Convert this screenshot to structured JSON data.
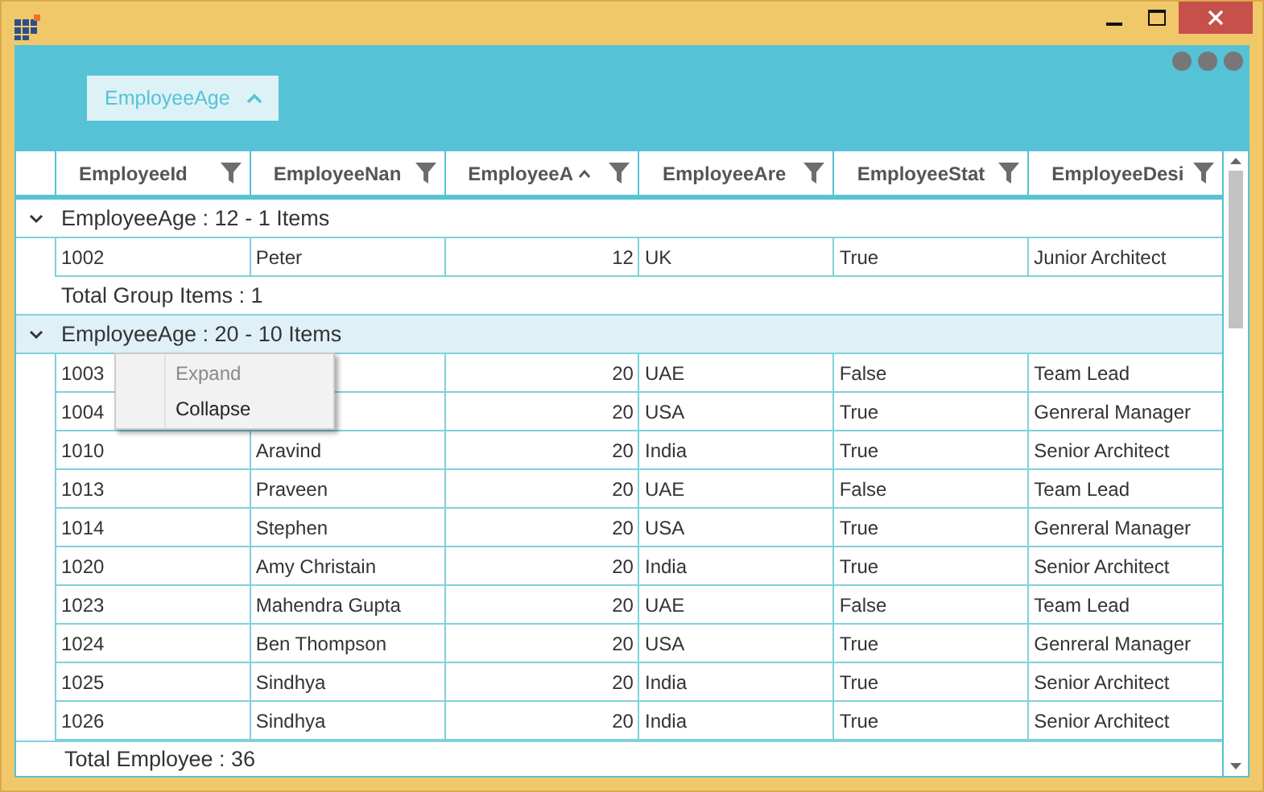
{
  "group_drop_area": {
    "grouped_columns": [
      {
        "label": "EmployeeAge",
        "sorted": true
      }
    ]
  },
  "columns": [
    {
      "label": "EmployeeId",
      "numeric": false,
      "sorted": false
    },
    {
      "label": "EmployeeNan",
      "numeric": false,
      "sorted": false
    },
    {
      "label": "EmployeeA",
      "numeric": true,
      "sorted": true
    },
    {
      "label": "EmployeeAre",
      "numeric": false,
      "sorted": false
    },
    {
      "label": "EmployeeStat",
      "numeric": false,
      "sorted": false
    },
    {
      "label": "EmployeeDesi",
      "numeric": false,
      "sorted": false
    }
  ],
  "groups": [
    {
      "header": "EmployeeAge : 12 - 1 Items",
      "expanded": true,
      "selected": false,
      "summary": "Total Group Items : 1",
      "rows": [
        {
          "cells": [
            "1002",
            "Peter",
            "12",
            "UK",
            "True",
            "Junior Architect"
          ]
        }
      ]
    },
    {
      "header": "EmployeeAge : 20 - 10 Items",
      "expanded": true,
      "selected": true,
      "rows": [
        {
          "cells": [
            "1003",
            null,
            "20",
            "UAE",
            "False",
            "Team Lead"
          ]
        },
        {
          "cells": [
            "1004",
            null,
            "20",
            "USA",
            "True",
            "Genreral Manager"
          ]
        },
        {
          "cells": [
            "1010",
            "Aravind",
            "20",
            "India",
            "True",
            "Senior Architect"
          ]
        },
        {
          "cells": [
            "1013",
            "Praveen",
            "20",
            "UAE",
            "False",
            "Team Lead"
          ]
        },
        {
          "cells": [
            "1014",
            "Stephen",
            "20",
            "USA",
            "True",
            "Genreral Manager"
          ]
        },
        {
          "cells": [
            "1020",
            "Amy Christain",
            "20",
            "India",
            "True",
            "Senior Architect"
          ]
        },
        {
          "cells": [
            "1023",
            "Mahendra Gupta",
            "20",
            "UAE",
            "False",
            "Team Lead"
          ]
        },
        {
          "cells": [
            "1024",
            "Ben Thompson",
            "20",
            "USA",
            "True",
            "Genreral Manager"
          ]
        },
        {
          "cells": [
            "1025",
            "Sindhya",
            "20",
            "India",
            "True",
            "Senior Architect"
          ]
        },
        {
          "cells": [
            "1026",
            "Sindhya",
            "20",
            "India",
            "True",
            "Senior Architect"
          ]
        }
      ]
    }
  ],
  "footer": "Total Employee : 36",
  "context_menu": {
    "items": [
      {
        "label": "Expand",
        "disabled": true
      },
      {
        "label": "Collapse",
        "disabled": false
      }
    ]
  }
}
